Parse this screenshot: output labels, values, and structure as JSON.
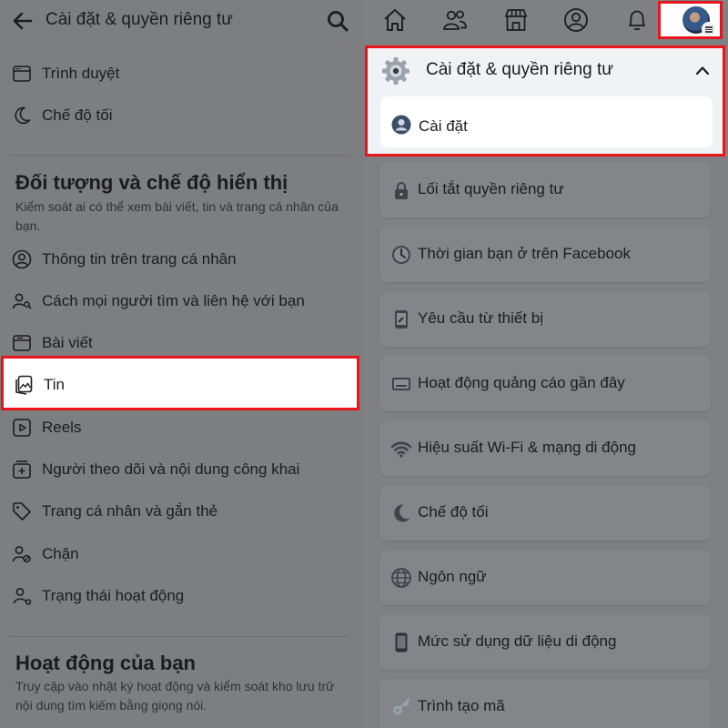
{
  "left": {
    "header": {
      "title": "Cài đặt & quyền riêng tư"
    },
    "top_items": [
      {
        "label": "Trình duyệt",
        "icon": "browser-icon"
      },
      {
        "label": "Chế độ tối",
        "icon": "moon-icon"
      }
    ],
    "audience_section": {
      "title": "Đối tượng và chế độ hiển thị",
      "description": "Kiểm soát ai có thể xem bài viết, tin và trang cá nhân của bạn.",
      "items": [
        {
          "label": "Thông tin trên trang cá nhân",
          "icon": "person-circle-icon"
        },
        {
          "label": "Cách mọi người tìm và liên hệ với bạn",
          "icon": "person-search-icon"
        },
        {
          "label": "Bài viết",
          "icon": "post-icon"
        },
        {
          "label": "Tin",
          "icon": "story-icon",
          "highlighted": true
        },
        {
          "label": "Reels",
          "icon": "reels-icon"
        },
        {
          "label": "Người theo dõi và nội dung công khai",
          "icon": "followers-icon"
        },
        {
          "label": "Trang cá nhân và gắn thẻ",
          "icon": "tag-icon"
        },
        {
          "label": "Chặn",
          "icon": "block-person-icon"
        },
        {
          "label": "Trạng thái hoạt động",
          "icon": "active-status-icon"
        }
      ]
    },
    "activity_section": {
      "title": "Hoạt động của bạn",
      "description": "Truy cập vào nhật ký hoạt động và kiểm soát kho lưu trữ nội dung tìm kiếm bằng giọng nói."
    }
  },
  "right": {
    "topbar_icons": [
      "home-icon",
      "friends-icon",
      "marketplace-icon",
      "profile-icon",
      "bell-icon",
      "avatar-menu-icon"
    ],
    "settings_group": {
      "title": "Cài đặt & quyền riêng tư",
      "expanded": true,
      "first_item": {
        "label": "Cài đặt",
        "icon": "person-avatar-icon"
      }
    },
    "menu_cards": [
      {
        "label": "Lối tắt quyền riêng tư",
        "icon": "lock-icon"
      },
      {
        "label": "Thời gian bạn ở trên Facebook",
        "icon": "clock-icon"
      },
      {
        "label": "Yêu cầu từ thiết bị",
        "icon": "device-request-icon"
      },
      {
        "label": "Hoạt động quảng cáo gần đây",
        "icon": "ad-activity-icon"
      },
      {
        "label": "Hiệu suất Wi-Fi & mạng di động",
        "icon": "wifi-icon"
      },
      {
        "label": "Chế độ tối",
        "icon": "moon-icon"
      },
      {
        "label": "Ngôn ngữ",
        "icon": "globe-icon"
      },
      {
        "label": "Mức sử dụng dữ liệu di động",
        "icon": "phone-icon"
      },
      {
        "label": "Trình tạo mã",
        "icon": "key-icon"
      }
    ]
  },
  "colors": {
    "highlight_border": "#e8151d",
    "dim_background": "#7d7e80",
    "card_background": "#848588",
    "text": "#1c1c1d"
  }
}
